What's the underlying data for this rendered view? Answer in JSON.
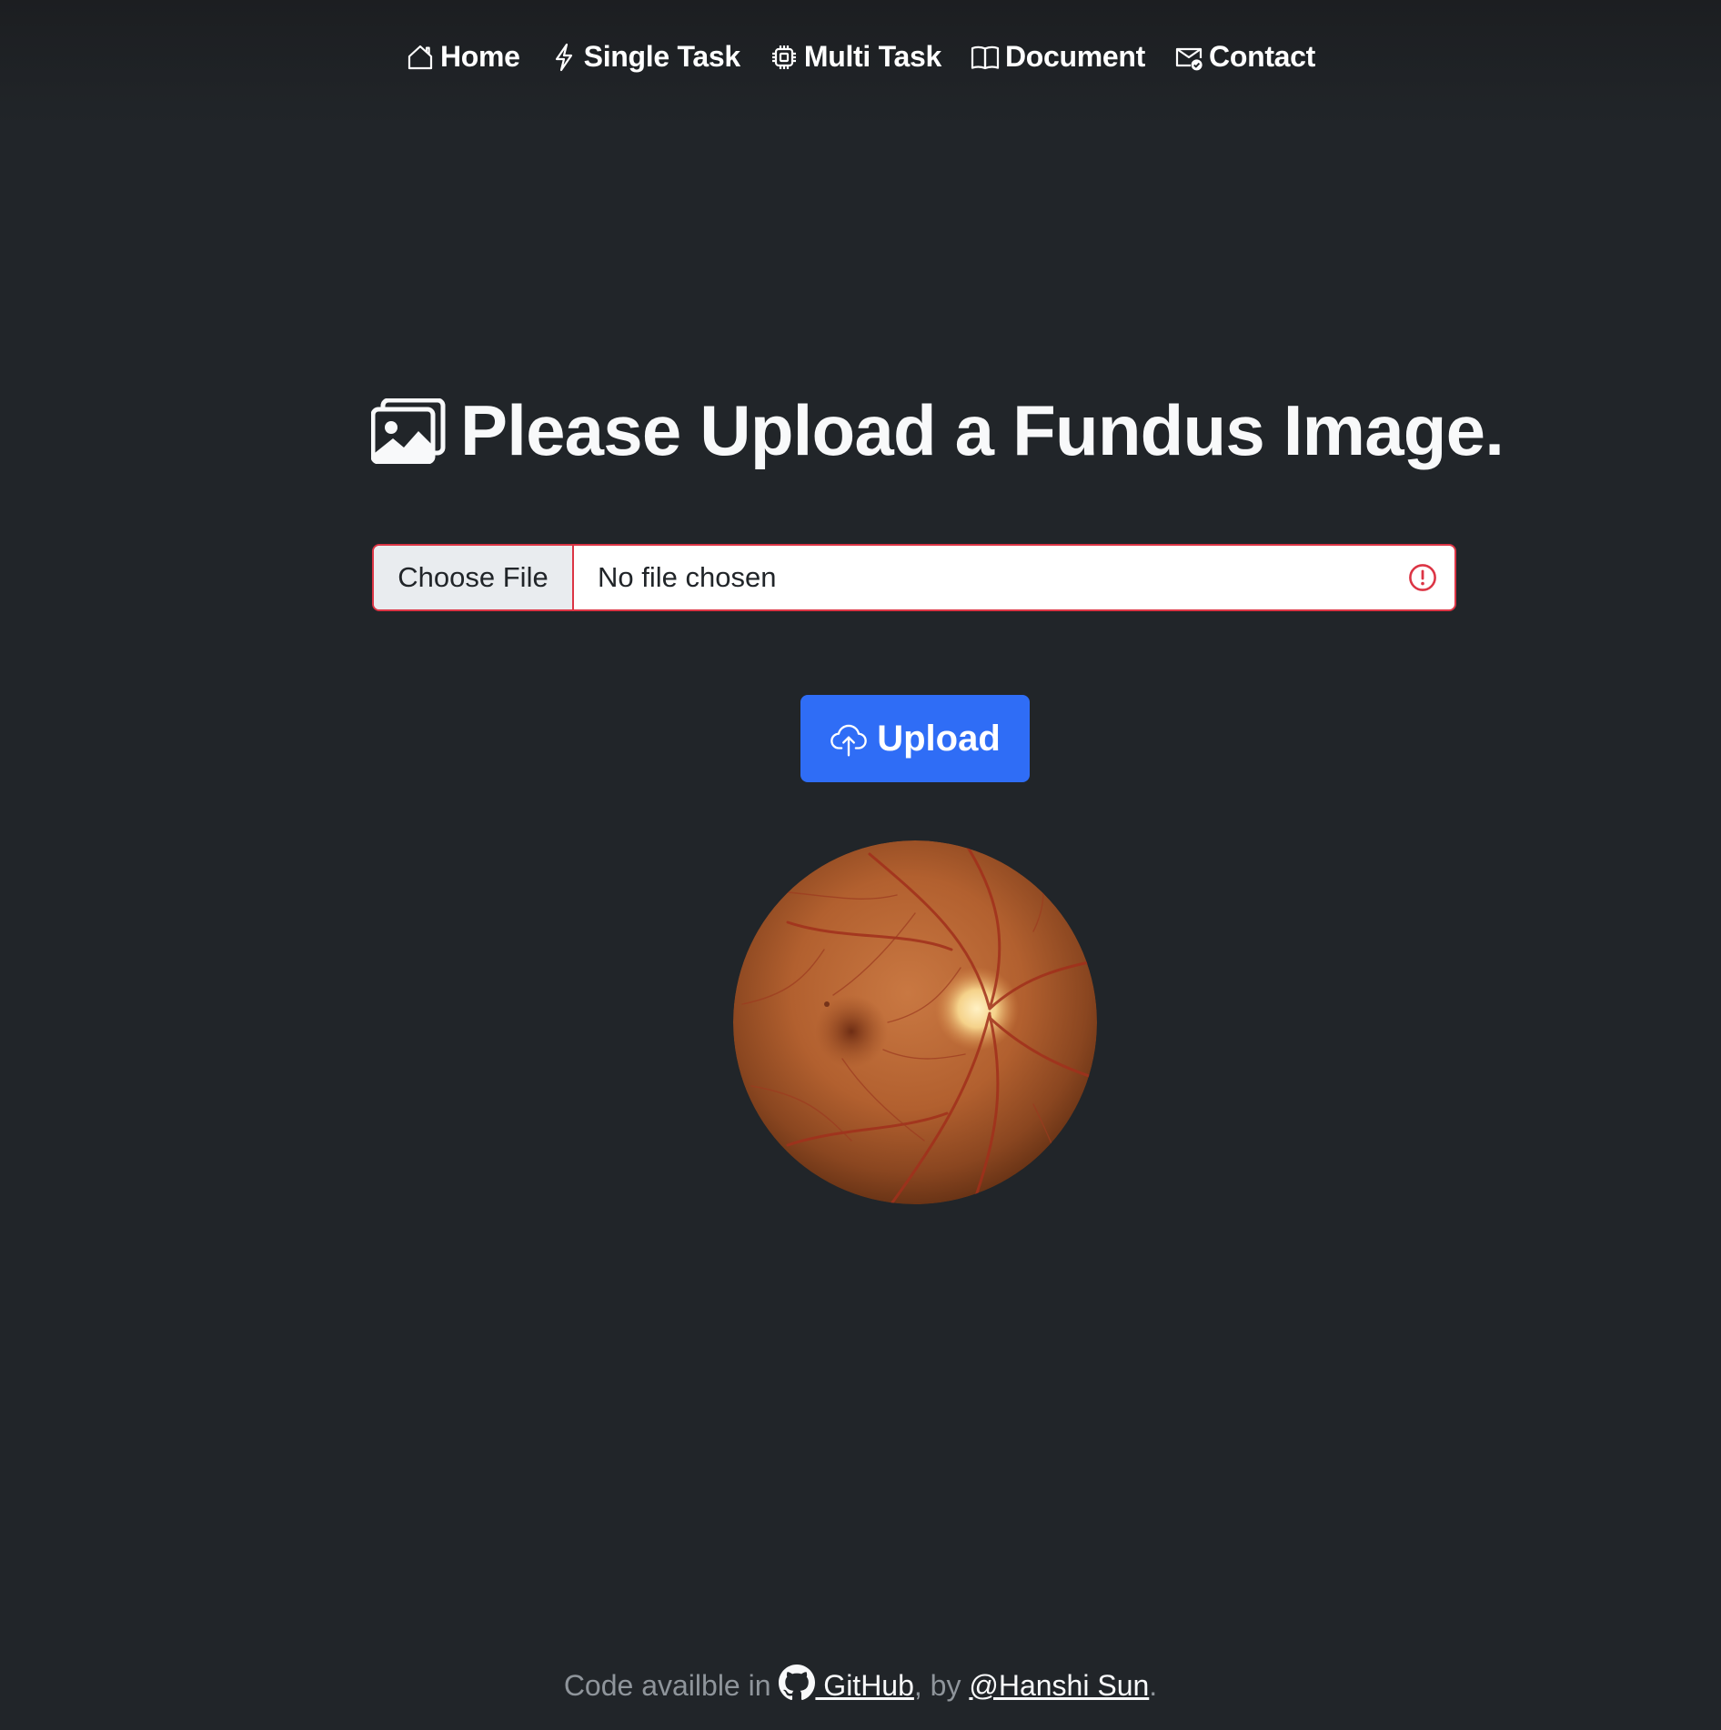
{
  "nav": {
    "items": [
      {
        "label": "Home",
        "icon": "house-icon"
      },
      {
        "label": "Single Task",
        "icon": "lightning-icon"
      },
      {
        "label": "Multi Task",
        "icon": "cpu-icon"
      },
      {
        "label": "Document",
        "icon": "book-icon"
      },
      {
        "label": "Contact",
        "icon": "envelope-check-icon"
      }
    ]
  },
  "main": {
    "heading": "Please Upload a Fundus Image.",
    "heading_icon": "images-icon",
    "file_input": {
      "button_label": "Choose File",
      "status": "No file chosen",
      "invalid_icon": "exclamation-circle-icon"
    },
    "upload_button": {
      "label": "Upload",
      "icon": "cloud-upload-icon"
    },
    "preview_image": "fundus-retina-image"
  },
  "footer": {
    "prefix": "Code availble in ",
    "github_label": " GitHub",
    "middle": ", by ",
    "author_label": "@Hanshi Sun",
    "suffix": "."
  },
  "colors": {
    "background": "#212529",
    "primary": "#2f6df6",
    "danger": "#dc3545",
    "muted_text": "#8f959b"
  }
}
